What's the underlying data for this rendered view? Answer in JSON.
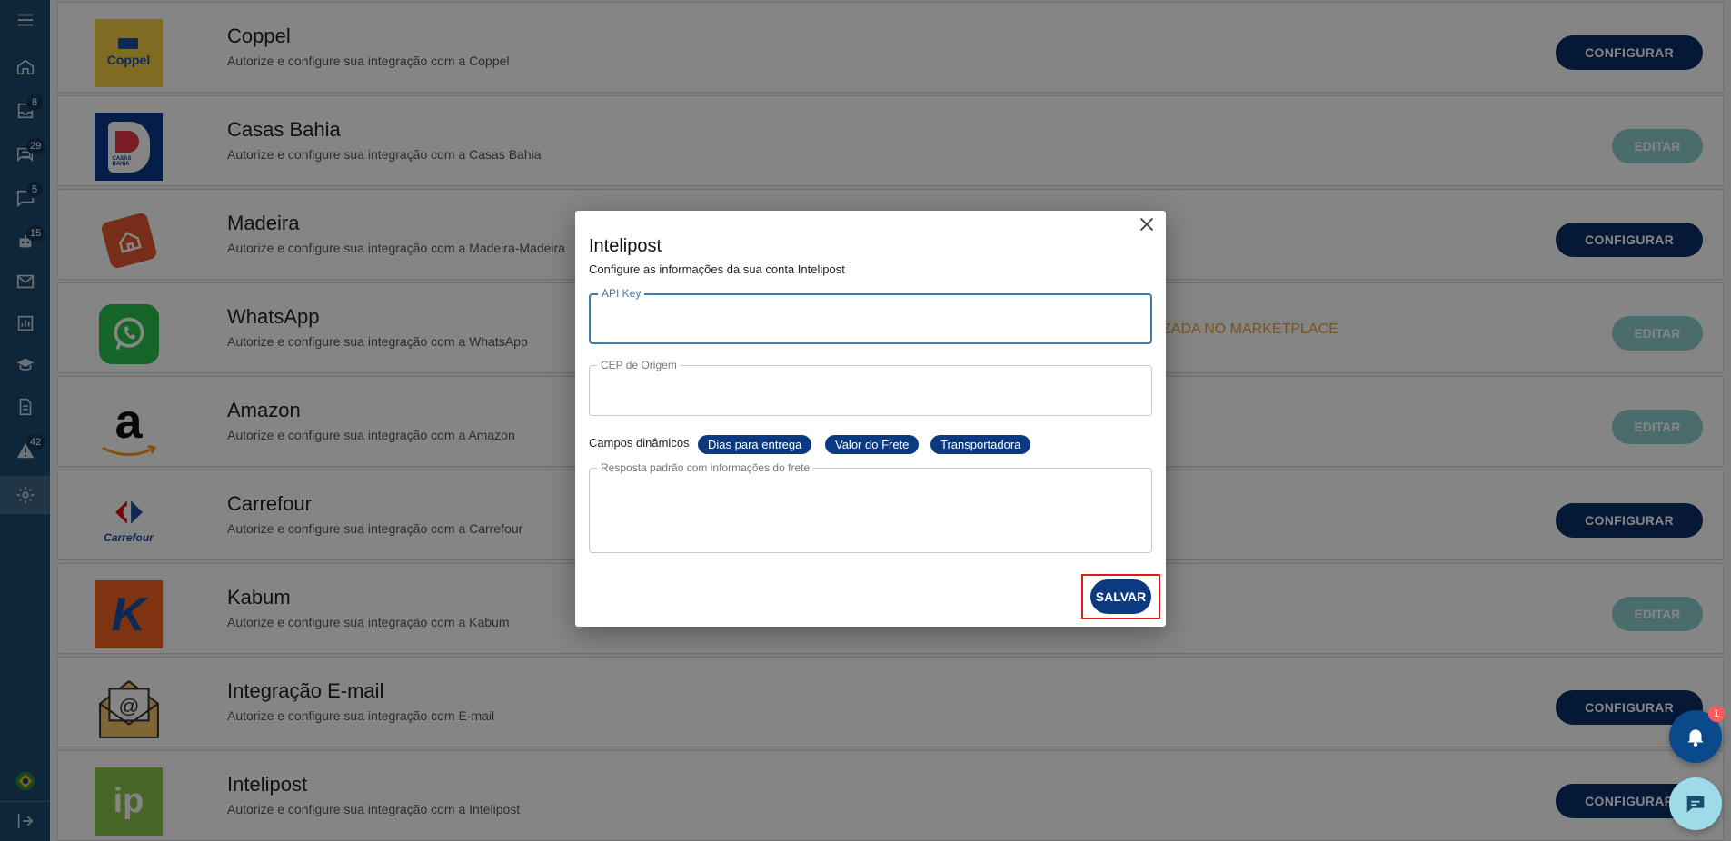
{
  "sidebar": {
    "items": [
      {
        "icon": "menu-icon"
      },
      {
        "icon": "home-icon"
      },
      {
        "icon": "inbox-icon",
        "badge": "8"
      },
      {
        "icon": "chat-icon",
        "badge": "29"
      },
      {
        "icon": "message-icon",
        "badge": "5"
      },
      {
        "icon": "bot-icon",
        "badge": "15"
      },
      {
        "icon": "mail-icon"
      },
      {
        "icon": "chart-icon"
      },
      {
        "icon": "graduation-icon"
      },
      {
        "icon": "document-icon"
      },
      {
        "icon": "warning-icon",
        "badge": "42"
      },
      {
        "icon": "gear-icon",
        "active": true
      },
      {
        "icon": "brazil-flag-icon"
      },
      {
        "icon": "logout-icon"
      }
    ]
  },
  "integrations": [
    {
      "title": "Coppel",
      "subtitle": "Autorize e configure sua integração com a Coppel",
      "action": "CONFIGURAR",
      "logo_text": "Coppel",
      "logo_bg": "#f4d03f"
    },
    {
      "title": "Casas Bahia",
      "subtitle": "Autorize e configure sua integração com a Casas Bahia",
      "action": "EDITAR",
      "logo_text": "CASAS BAHIA",
      "logo_bg": "#0b3a8c"
    },
    {
      "title": "Madeira",
      "subtitle": "Autorize e configure sua integração com a Madeira-Madeira",
      "action": "CONFIGURAR",
      "logo_bg": "#e4572e"
    },
    {
      "title": "WhatsApp",
      "subtitle": "Autorize e configure sua integração com a WhatsApp",
      "action": "EDITAR",
      "note": "ZADA NO MARKETPLACE",
      "logo_bg": "#27c24c"
    },
    {
      "title": "Amazon",
      "subtitle": "Autorize e configure sua integração com a Amazon",
      "action": "EDITAR",
      "logo_text": "a",
      "logo_bg": "#ffffff"
    },
    {
      "title": "Carrefour",
      "subtitle": "Autorize e configure sua integração com a Carrefour",
      "action": "CONFIGURAR",
      "logo_text": "Carrefour",
      "logo_bg": "#ffffff"
    },
    {
      "title": "Kabum",
      "subtitle": "Autorize e configure sua integração com a Kabum",
      "action": "EDITAR",
      "logo_text": "K",
      "logo_bg": "#f26522"
    },
    {
      "title": "Integração E-mail",
      "subtitle": "Autorize e configure sua integração com E-mail",
      "action": "CONFIGURAR",
      "logo_text": "@",
      "logo_bg": "#ffffff"
    },
    {
      "title": "Intelipost",
      "subtitle": "Autorize e configure sua integração com a Intelipost",
      "action": "CONFIGURAR",
      "logo_text": "ip",
      "logo_bg": "#8bc34a"
    }
  ],
  "modal": {
    "title": "Intelipost",
    "subtitle": "Configure as informações da sua conta Intelipost",
    "api_key_label": "API Key",
    "api_key_value": "",
    "cep_label": "CEP de Origem",
    "cep_value": "",
    "dynamic_label": "Campos dinâmicos",
    "chips": [
      "Dias para entrega",
      "Valor do Frete",
      "Transportadora"
    ],
    "response_label": "Resposta padrão com informações do frete",
    "response_value": "",
    "save_label": "SALVAR"
  },
  "notifications": {
    "badge": "1"
  },
  "colors": {
    "sidebar": "#1c4a6e",
    "primary": "#0b2f66",
    "edit": "#8ecfcf",
    "highlight": "#e01a1a"
  }
}
